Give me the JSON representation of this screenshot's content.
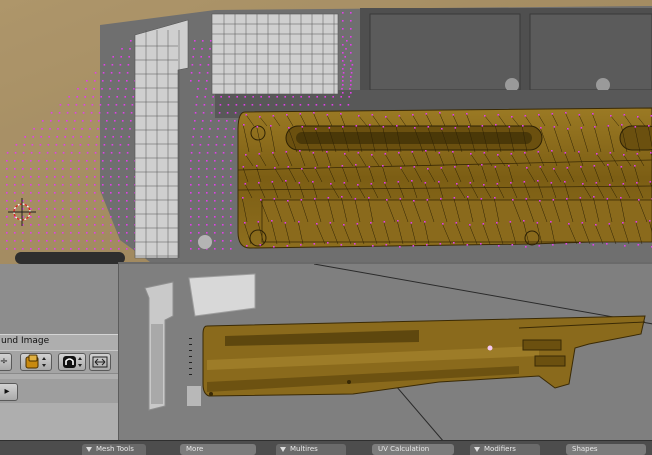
{
  "background_panel": {
    "header_label": "und Image",
    "stepper_left": "÷",
    "stepper_right": "÷",
    "arrow_button": "▸"
  },
  "bottom_tabs": [
    {
      "label": "Mesh Tools",
      "field": "More"
    },
    {
      "label": "Multires",
      "field": "UV Calculation"
    },
    {
      "label": "Modifiers",
      "field": "Shapes"
    }
  ],
  "icons": [
    "image-browse-icon",
    "lock-icon",
    "resize-icon",
    "cursor-icon",
    "left-arrow-icon"
  ],
  "colors": {
    "uv_vertex": "#e040e8",
    "texture_brown": "#8a6a1c",
    "viewport_grey": "#7f7f7f",
    "panel_grey": "#aeaeae",
    "header_dark": "#4d4d4d"
  }
}
